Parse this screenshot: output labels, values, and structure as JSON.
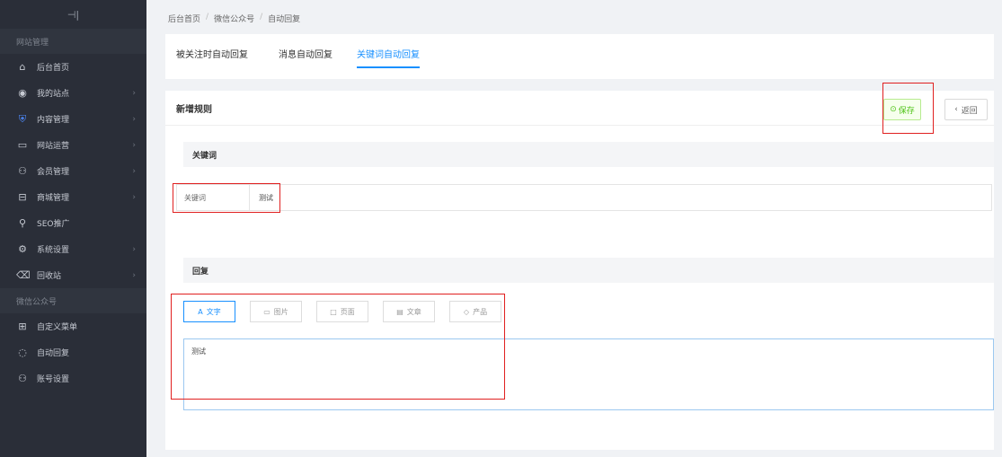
{
  "sidebar": {
    "toggle_icon": "collapse-icon",
    "groups": [
      {
        "title": "网站管理",
        "items": [
          {
            "label": "后台首页",
            "icon": "⌂",
            "arrow": false,
            "active": false
          },
          {
            "label": "我的站点",
            "icon": "◉",
            "arrow": true,
            "active": false
          },
          {
            "label": "内容管理",
            "icon": "⛨",
            "arrow": true,
            "active": true
          },
          {
            "label": "网站运营",
            "icon": "▭",
            "arrow": true,
            "active": false
          },
          {
            "label": "会员管理",
            "icon": "⚇",
            "arrow": true,
            "active": false
          },
          {
            "label": "商城管理",
            "icon": "⊟",
            "arrow": true,
            "active": false
          },
          {
            "label": "SEO推广",
            "icon": "⚲",
            "arrow": false,
            "active": false
          },
          {
            "label": "系统设置",
            "icon": "⚙",
            "arrow": true,
            "active": false
          },
          {
            "label": "回收站",
            "icon": "⌫",
            "arrow": true,
            "active": false
          }
        ]
      },
      {
        "title": "微信公众号",
        "items": [
          {
            "label": "自定义菜单",
            "icon": "⊞",
            "arrow": false,
            "active": false
          },
          {
            "label": "自动回复",
            "icon": "◌",
            "arrow": false,
            "active": false
          },
          {
            "label": "账号设置",
            "icon": "⚇",
            "arrow": false,
            "active": false
          }
        ]
      }
    ]
  },
  "breadcrumb": [
    "后台首页",
    "微信公众号",
    "自动回复"
  ],
  "breadcrumb_sep": "/",
  "tabs": [
    {
      "label": "被关注时自动回复",
      "active": false
    },
    {
      "label": "消息自动回复",
      "active": false
    },
    {
      "label": "关键词自动回复",
      "active": true
    }
  ],
  "editor": {
    "title": "新增规则",
    "save_label": "保存",
    "back_label": "返回",
    "keyword_section": "关键词",
    "keyword_label": "关键词",
    "keyword_value": "测试",
    "reply_section": "回复",
    "reply_types": [
      {
        "label": "文字",
        "icon": "A",
        "active": true
      },
      {
        "label": "图片",
        "icon": "▭",
        "active": false
      },
      {
        "label": "页面",
        "icon": "□",
        "active": false
      },
      {
        "label": "文章",
        "icon": "▤",
        "active": false
      },
      {
        "label": "产品",
        "icon": "◇",
        "active": false
      }
    ],
    "reply_text": "测试"
  },
  "colors": {
    "accent": "#1890ff",
    "save": "#52c41a",
    "highlight": "#e02020",
    "sidebar_bg": "#2a2e38"
  }
}
